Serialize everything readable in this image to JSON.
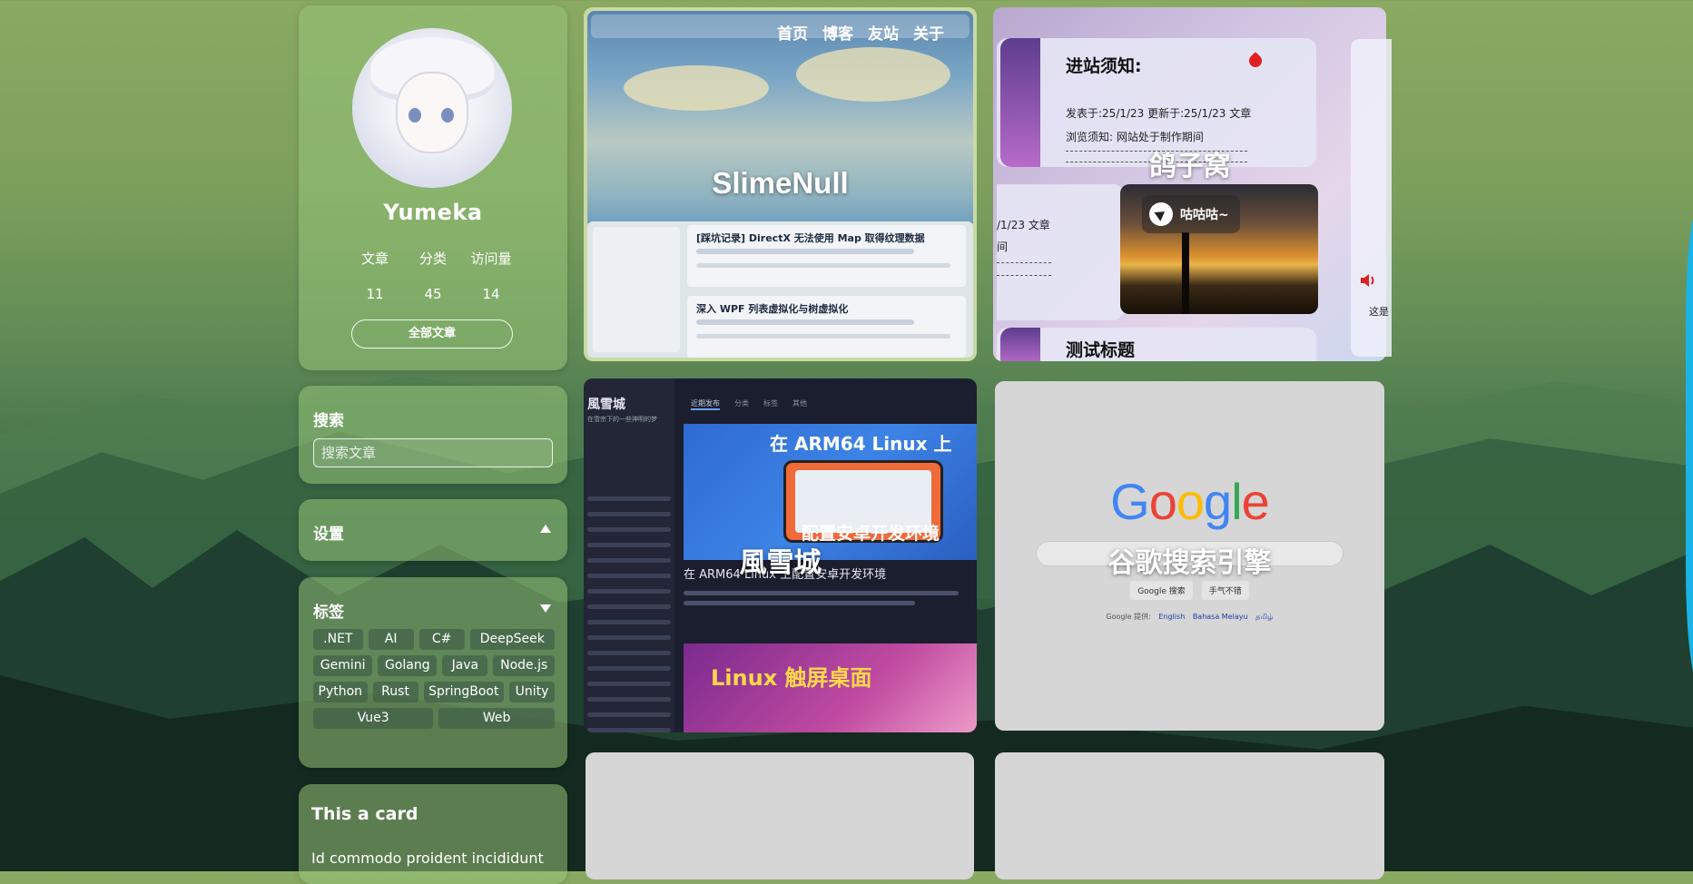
{
  "profile": {
    "name": "Yumeka",
    "stats": [
      {
        "label": "文章",
        "value": "11"
      },
      {
        "label": "分类",
        "value": "45"
      },
      {
        "label": "访问量",
        "value": "14"
      }
    ],
    "all_posts_label": "全部文章"
  },
  "search": {
    "title": "搜索",
    "placeholder": "搜索文章"
  },
  "settings": {
    "title": "设置"
  },
  "tags": {
    "title": "标签",
    "items": [
      ".NET",
      "AI",
      "C#",
      "DeepSeek",
      "Gemini",
      "Golang",
      "Java",
      "Node.js",
      "Python",
      "Rust",
      "SpringBoot",
      "Unity",
      "Vue3",
      "Web"
    ]
  },
  "note_card": {
    "title": "This a card",
    "body": "Id commodo proident incididunt"
  },
  "tiles": {
    "slimenull": {
      "title": "SlimeNull",
      "nav": [
        "首页",
        "博客",
        "友站",
        "关于"
      ],
      "posts": [
        "[踩坑记录] DirectX 无法使用 Map 取得纹理数据",
        "深入 WPF 列表虚拟化与树虚拟化"
      ]
    },
    "geziwo": {
      "title": "鸽子窝",
      "post_title": "进站须知:",
      "post_meta": "发表于:25/1/23 更新于:25/1/23 文章",
      "post_body": "浏览须知: 网站处于制作期间",
      "side_meta": "/1/23 文章",
      "side_text": "间",
      "chip": "咕咕咕~",
      "post2_title": "测试标题",
      "right_text": "这是"
    },
    "fengxuecheng": {
      "title": "風雪城",
      "site_name": "風雪城",
      "site_sub": "在雪宗下的一些神明的梦",
      "tabs": [
        "近期发布",
        "分类",
        "标签",
        "其他"
      ],
      "banner_text": "在 ARM64 Linux 上",
      "banner_text2": "配置安卓开发环境",
      "post_title": "在 ARM64 Linux 上配置安卓开发环境",
      "banner2_text": "Linux 触屏桌面"
    },
    "google": {
      "title": "谷歌搜索引擎",
      "logo": "Google",
      "btn_search": "Google 搜索",
      "btn_lucky": "手气不错",
      "langs_prefix": "Google 提供:",
      "langs": [
        "English",
        "Bahasa Melayu",
        "தமிழ்"
      ]
    }
  },
  "colors": {
    "google_blue": "#4285F4",
    "google_red": "#EA4335",
    "google_yellow": "#FBBC05",
    "google_green": "#34A853",
    "accent_edge": "#1ab3e6"
  }
}
